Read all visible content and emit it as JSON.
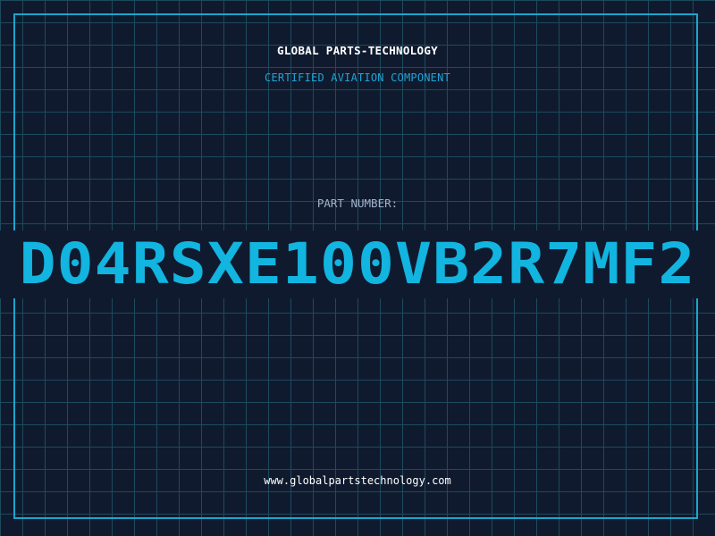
{
  "header": {
    "company": "GLOBAL PARTS-TECHNOLOGY",
    "subtitle": "CERTIFIED AVIATION COMPONENT"
  },
  "part": {
    "label": "PART NUMBER:",
    "number": "D04RSXE100VB2R7MF2"
  },
  "footer": {
    "website": "www.globalpartstechnology.com"
  },
  "colors": {
    "background": "#101a2e",
    "grid": "#1d4a5c",
    "accent": "#12b4e0",
    "frame": "#1aa6cc"
  }
}
